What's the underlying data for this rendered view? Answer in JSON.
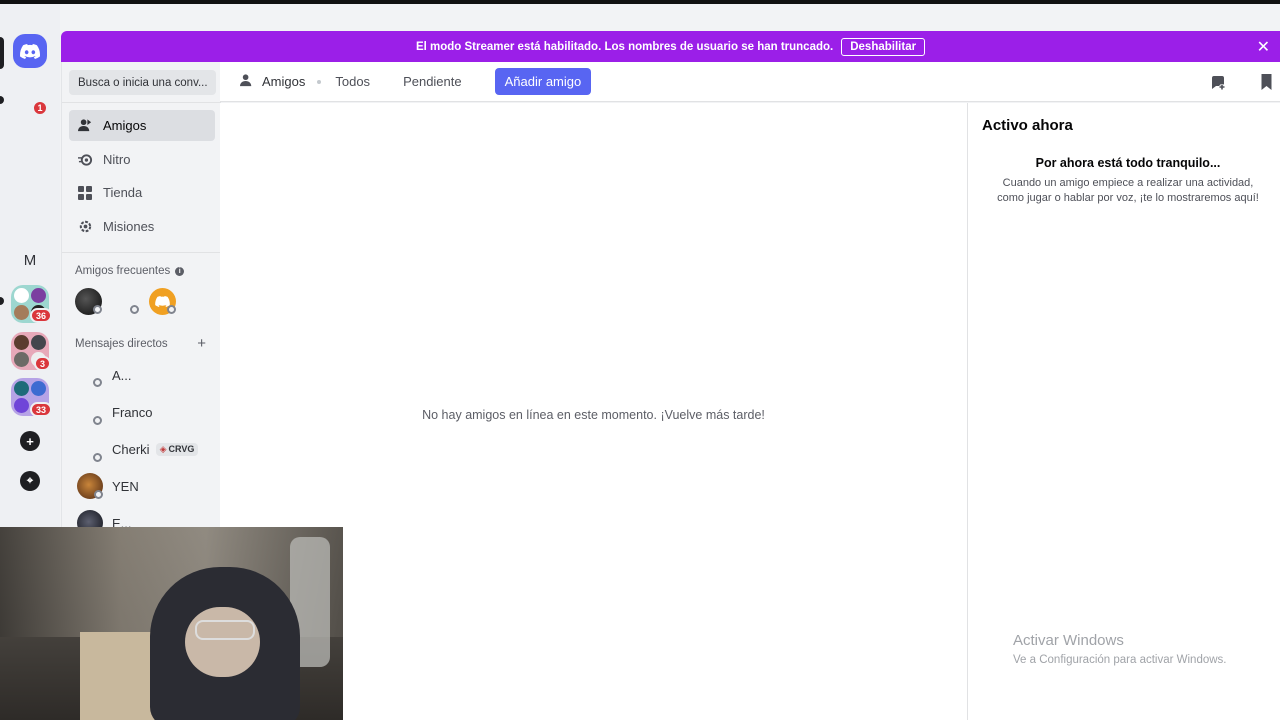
{
  "banner": {
    "message": "El modo Streamer está habilitado. Los nombres de usuario se han truncado.",
    "disable_label": "Deshabilitar",
    "close_glyph": "✕",
    "color": "#9b1fe8"
  },
  "rail": {
    "notification_count": "1",
    "guild_letter": "M",
    "folders": [
      {
        "badge": "36"
      },
      {
        "badge": "3"
      },
      {
        "badge": "33"
      }
    ],
    "add_glyph": "+",
    "explore_glyph": "⌖"
  },
  "sidebar": {
    "search_placeholder": "Busca o inicia una conv...",
    "nav": [
      {
        "label": "Amigos",
        "icon": "friends-icon"
      },
      {
        "label": "Nitro",
        "icon": "nitro-icon"
      },
      {
        "label": "Tienda",
        "icon": "shop-icon"
      },
      {
        "label": "Misiones",
        "icon": "quests-icon"
      }
    ],
    "frequent_title": "Amigos frecuentes",
    "dm_title": "Mensajes directos",
    "dms": [
      {
        "name": "A..."
      },
      {
        "name": "Franco"
      },
      {
        "name": "Cherki",
        "tag": "CRVG"
      },
      {
        "name": "YEN"
      },
      {
        "name": "E..."
      }
    ]
  },
  "header": {
    "title": "Amigos",
    "tabs": [
      "Todos",
      "Pendiente"
    ],
    "add_friend_label": "Añadir amigo"
  },
  "main": {
    "empty_message": "No hay amigos en línea en este momento. ¡Vuelve más tarde!"
  },
  "activity": {
    "title": "Activo ahora",
    "quiet_title": "Por ahora está todo tranquilo...",
    "quiet_desc_line1": "Cuando un amigo empiece a realizar una actividad,",
    "quiet_desc_line2": "como jugar o hablar por voz, ¡te lo mostraremos aquí!"
  },
  "watermark": {
    "line1": "Activar Windows",
    "line2": "Ve a Configuración para activar Windows."
  },
  "colors": {
    "blurple": "#5865f2",
    "badge_red": "#da373c"
  }
}
